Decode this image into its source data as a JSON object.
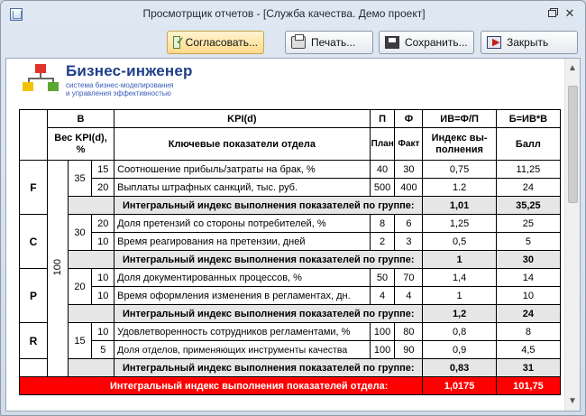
{
  "window": {
    "title": "Просмотрщик отчетов - [Служба качества. Демо проект]"
  },
  "toolbar": {
    "approve_label": "Согласовать...",
    "print_label": "Печать...",
    "save_label": "Сохранить...",
    "close_label": "Закрыть"
  },
  "logo": {
    "title": "Бизнес-инженер",
    "subtitle_line1": "система бизнес-моделирования",
    "subtitle_line2": "и управления эффективностью"
  },
  "header": {
    "col_b": "B",
    "col_kpi": "KPI(d)",
    "col_p": "П",
    "col_f": "Ф",
    "col_iv": "ИВ=Ф/П",
    "col_bscore": "Б=ИВ*B",
    "weight": "Вес KPI(d), %",
    "indicators": "Ключевые показатели отдела",
    "plan": "План",
    "fact": "Факт",
    "index": "Индекс вы-полнения",
    "score": "Балл"
  },
  "table": {
    "total_weight": "100",
    "group_label": "Интегральный индекс выполнения показателей по группе:",
    "groups": [
      {
        "code": "F",
        "weight": "35",
        "rows": [
          {
            "w": "15",
            "name": "Соотношение прибыль/затраты на брак, %",
            "plan": "40",
            "fact": "30",
            "index": "0,75",
            "score": "11,25"
          },
          {
            "w": "20",
            "name": "Выплаты штрафных санкций, тыс. руб.",
            "plan": "500",
            "fact": "400",
            "index": "1.2",
            "score": "24"
          }
        ],
        "index": "1,01",
        "score": "35,25"
      },
      {
        "code": "C",
        "weight": "30",
        "rows": [
          {
            "w": "20",
            "name": "Доля претензий со стороны потребителей, %",
            "plan": "8",
            "fact": "6",
            "index": "1,25",
            "score": "25"
          },
          {
            "w": "10",
            "name": "Время реагирования на претензии, дней",
            "plan": "2",
            "fact": "3",
            "index": "0,5",
            "score": "5"
          }
        ],
        "index": "1",
        "score": "30"
      },
      {
        "code": "P",
        "weight": "20",
        "rows": [
          {
            "w": "10",
            "name": "Доля документированных процессов, %",
            "plan": "50",
            "fact": "70",
            "index": "1,4",
            "score": "14"
          },
          {
            "w": "10",
            "name": "Время оформления изменения в регламентах, дн.",
            "plan": "4",
            "fact": "4",
            "index": "1",
            "score": "10"
          }
        ],
        "index": "1,2",
        "score": "24"
      },
      {
        "code": "R",
        "weight": "15",
        "rows": [
          {
            "w": "10",
            "name": "Удовлетворенность сотрудников регламентами, %",
            "plan": "100",
            "fact": "80",
            "index": "0,8",
            "score": "8"
          },
          {
            "w": "5",
            "name": "Доля отделов, применяющих инструменты качества",
            "plan": "100",
            "fact": "90",
            "index": "0,9",
            "score": "4,5"
          }
        ],
        "index": "0,83",
        "score": "31"
      }
    ],
    "total_label": "Интегральный индекс выполнения показателей отдела:",
    "total_index": "1,0175",
    "total_score": "101,75"
  },
  "colors": {
    "total_row": "#ff0000",
    "group_row": "#e6e6e6",
    "logo_blue": "#1f3f8a"
  }
}
